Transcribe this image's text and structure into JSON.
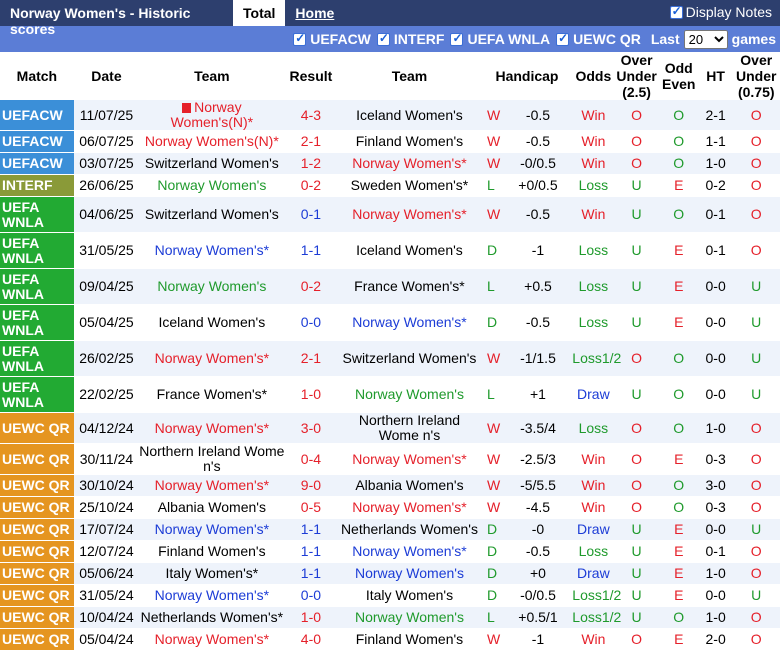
{
  "header": {
    "title": "Norway Women's - Historic scores",
    "tab_total": "Total",
    "tab_home": "Home",
    "display_notes": "Display Notes"
  },
  "filters": {
    "items": [
      "UEFACW",
      "INTERF",
      "UEFA WNLA",
      "UEWC QR"
    ],
    "last_label": "Last",
    "games_value": "20",
    "games_label": "games"
  },
  "columns": [
    "Match",
    "Date",
    "Team",
    "Result",
    "Team",
    "Handicap",
    "Odds",
    "Over Under (2.5)",
    "Odd Even",
    "HT",
    "Over Under (0.75)"
  ],
  "colors": {
    "win": "#e5202a",
    "draw": "#1c3cd6",
    "loss": "#1f9a2c",
    "uefacw": "#3b8fd8",
    "interf": "#8a9a38",
    "wnla": "#22aa33",
    "uewc": "#e59520"
  },
  "rows": [
    {
      "comp": "UEFACW",
      "ctype": "uefacw",
      "date": "11/07/25",
      "home": "Norway Women's(N)*",
      "hc": "red",
      "flag": true,
      "score": "4-3",
      "sc": "red",
      "away": "Iceland Women's",
      "ac": "black",
      "wl": "W",
      "wc": "red",
      "hcap": "-0.5",
      "odds": "Win",
      "oc": "red",
      "ou": "O",
      "ouc": "red",
      "oe": "O",
      "oec": "green",
      "ht": "2-1",
      "ou2": "O",
      "ou2c": "red",
      "tall": false
    },
    {
      "comp": "UEFACW",
      "ctype": "uefacw",
      "date": "06/07/25",
      "home": "Norway Women's(N)*",
      "hc": "red",
      "flag": false,
      "score": "2-1",
      "sc": "red",
      "away": "Finland Women's",
      "ac": "black",
      "wl": "W",
      "wc": "red",
      "hcap": "-0.5",
      "odds": "Win",
      "oc": "red",
      "ou": "O",
      "ouc": "red",
      "oe": "O",
      "oec": "green",
      "ht": "1-1",
      "ou2": "O",
      "ou2c": "red",
      "tall": false
    },
    {
      "comp": "UEFACW",
      "ctype": "uefacw",
      "date": "03/07/25",
      "home": "Switzerland Women's",
      "hc": "black",
      "flag": false,
      "score": "1-2",
      "sc": "red",
      "away": "Norway Women's*",
      "ac": "red",
      "wl": "W",
      "wc": "red",
      "hcap": "-0/0.5",
      "odds": "Win",
      "oc": "red",
      "ou": "O",
      "ouc": "red",
      "oe": "O",
      "oec": "green",
      "ht": "1-0",
      "ou2": "O",
      "ou2c": "red",
      "tall": false
    },
    {
      "comp": "INTERF",
      "ctype": "interf",
      "date": "26/06/25",
      "home": "Norway Women's",
      "hc": "green",
      "flag": false,
      "score": "0-2",
      "sc": "red",
      "away": "Sweden Women's*",
      "ac": "black",
      "wl": "L",
      "wc": "green",
      "hcap": "+0/0.5",
      "odds": "Loss",
      "oc": "green",
      "ou": "U",
      "ouc": "green",
      "oe": "E",
      "oec": "red",
      "ht": "0-2",
      "ou2": "O",
      "ou2c": "red",
      "tall": false
    },
    {
      "comp": "UEFA WNLA",
      "ctype": "wnla",
      "date": "04/06/25",
      "home": "Switzerland Women's",
      "hc": "black",
      "flag": false,
      "score": "0-1",
      "sc": "blue",
      "away": "Norway Women's*",
      "ac": "red",
      "wl": "W",
      "wc": "red",
      "hcap": "-0.5",
      "odds": "Win",
      "oc": "red",
      "ou": "U",
      "ouc": "green",
      "oe": "O",
      "oec": "green",
      "ht": "0-1",
      "ou2": "O",
      "ou2c": "red",
      "tall": true
    },
    {
      "comp": "UEFA WNLA",
      "ctype": "wnla",
      "date": "31/05/25",
      "home": "Norway Women's*",
      "hc": "blue",
      "flag": false,
      "score": "1-1",
      "sc": "blue",
      "away": "Iceland Women's",
      "ac": "black",
      "wl": "D",
      "wc": "green",
      "hcap": "-1",
      "odds": "Loss",
      "oc": "green",
      "ou": "U",
      "ouc": "green",
      "oe": "E",
      "oec": "red",
      "ht": "0-1",
      "ou2": "O",
      "ou2c": "red",
      "tall": true
    },
    {
      "comp": "UEFA WNLA",
      "ctype": "wnla",
      "date": "09/04/25",
      "home": "Norway Women's",
      "hc": "green",
      "flag": false,
      "score": "0-2",
      "sc": "red",
      "away": "France Women's*",
      "ac": "black",
      "wl": "L",
      "wc": "green",
      "hcap": "+0.5",
      "odds": "Loss",
      "oc": "green",
      "ou": "U",
      "ouc": "green",
      "oe": "E",
      "oec": "red",
      "ht": "0-0",
      "ou2": "U",
      "ou2c": "green",
      "tall": true
    },
    {
      "comp": "UEFA WNLA",
      "ctype": "wnla",
      "date": "05/04/25",
      "home": "Iceland Women's",
      "hc": "black",
      "flag": false,
      "score": "0-0",
      "sc": "blue",
      "away": "Norway Women's*",
      "ac": "blue",
      "wl": "D",
      "wc": "green",
      "hcap": "-0.5",
      "odds": "Loss",
      "oc": "green",
      "ou": "U",
      "ouc": "green",
      "oe": "E",
      "oec": "red",
      "ht": "0-0",
      "ou2": "U",
      "ou2c": "green",
      "tall": true
    },
    {
      "comp": "UEFA WNLA",
      "ctype": "wnla",
      "date": "26/02/25",
      "home": "Norway Women's*",
      "hc": "red",
      "flag": false,
      "score": "2-1",
      "sc": "red",
      "away": "Switzerland Women's",
      "ac": "black",
      "wl": "W",
      "wc": "red",
      "hcap": "-1/1.5",
      "odds": "Loss1/2",
      "oc": "green",
      "ou": "O",
      "ouc": "red",
      "oe": "O",
      "oec": "green",
      "ht": "0-0",
      "ou2": "U",
      "ou2c": "green",
      "tall": true
    },
    {
      "comp": "UEFA WNLA",
      "ctype": "wnla",
      "date": "22/02/25",
      "home": "France Women's*",
      "hc": "black",
      "flag": false,
      "score": "1-0",
      "sc": "red",
      "away": "Norway Women's",
      "ac": "green",
      "wl": "L",
      "wc": "green",
      "hcap": "+1",
      "odds": "Draw",
      "oc": "blue",
      "ou": "U",
      "ouc": "green",
      "oe": "O",
      "oec": "green",
      "ht": "0-0",
      "ou2": "U",
      "ou2c": "green",
      "tall": true
    },
    {
      "comp": "UEWC QR",
      "ctype": "uewc",
      "date": "04/12/24",
      "home": "Norway Women's*",
      "hc": "red",
      "flag": false,
      "score": "3-0",
      "sc": "red",
      "away": "Northern Ireland Wome n's",
      "ac": "black",
      "wl": "W",
      "wc": "red",
      "hcap": "-3.5/4",
      "odds": "Loss",
      "oc": "green",
      "ou": "O",
      "ouc": "red",
      "oe": "O",
      "oec": "green",
      "ht": "1-0",
      "ou2": "O",
      "ou2c": "red",
      "tall": false
    },
    {
      "comp": "UEWC QR",
      "ctype": "uewc",
      "date": "30/11/24",
      "home": "Northern Ireland Wome n's",
      "hc": "black",
      "flag": false,
      "score": "0-4",
      "sc": "red",
      "away": "Norway Women's*",
      "ac": "red",
      "wl": "W",
      "wc": "red",
      "hcap": "-2.5/3",
      "odds": "Win",
      "oc": "red",
      "ou": "O",
      "ouc": "red",
      "oe": "E",
      "oec": "red",
      "ht": "0-3",
      "ou2": "O",
      "ou2c": "red",
      "tall": false
    },
    {
      "comp": "UEWC QR",
      "ctype": "uewc",
      "date": "30/10/24",
      "home": "Norway Women's*",
      "hc": "red",
      "flag": false,
      "score": "9-0",
      "sc": "red",
      "away": "Albania Women's",
      "ac": "black",
      "wl": "W",
      "wc": "red",
      "hcap": "-5/5.5",
      "odds": "Win",
      "oc": "red",
      "ou": "O",
      "ouc": "red",
      "oe": "O",
      "oec": "green",
      "ht": "3-0",
      "ou2": "O",
      "ou2c": "red",
      "tall": false
    },
    {
      "comp": "UEWC QR",
      "ctype": "uewc",
      "date": "25/10/24",
      "home": "Albania Women's",
      "hc": "black",
      "flag": false,
      "score": "0-5",
      "sc": "red",
      "away": "Norway Women's*",
      "ac": "red",
      "wl": "W",
      "wc": "red",
      "hcap": "-4.5",
      "odds": "Win",
      "oc": "red",
      "ou": "O",
      "ouc": "red",
      "oe": "O",
      "oec": "green",
      "ht": "0-3",
      "ou2": "O",
      "ou2c": "red",
      "tall": false
    },
    {
      "comp": "UEWC QR",
      "ctype": "uewc",
      "date": "17/07/24",
      "home": "Norway Women's*",
      "hc": "blue",
      "flag": false,
      "score": "1-1",
      "sc": "blue",
      "away": "Netherlands Women's",
      "ac": "black",
      "wl": "D",
      "wc": "green",
      "hcap": "-0",
      "odds": "Draw",
      "oc": "blue",
      "ou": "U",
      "ouc": "green",
      "oe": "E",
      "oec": "red",
      "ht": "0-0",
      "ou2": "U",
      "ou2c": "green",
      "tall": false
    },
    {
      "comp": "UEWC QR",
      "ctype": "uewc",
      "date": "12/07/24",
      "home": "Finland Women's",
      "hc": "black",
      "flag": false,
      "score": "1-1",
      "sc": "blue",
      "away": "Norway Women's*",
      "ac": "blue",
      "wl": "D",
      "wc": "green",
      "hcap": "-0.5",
      "odds": "Loss",
      "oc": "green",
      "ou": "U",
      "ouc": "green",
      "oe": "E",
      "oec": "red",
      "ht": "0-1",
      "ou2": "O",
      "ou2c": "red",
      "tall": false
    },
    {
      "comp": "UEWC QR",
      "ctype": "uewc",
      "date": "05/06/24",
      "home": "Italy Women's*",
      "hc": "black",
      "flag": false,
      "score": "1-1",
      "sc": "blue",
      "away": "Norway Women's",
      "ac": "blue",
      "wl": "D",
      "wc": "green",
      "hcap": "+0",
      "odds": "Draw",
      "oc": "blue",
      "ou": "U",
      "ouc": "green",
      "oe": "E",
      "oec": "red",
      "ht": "1-0",
      "ou2": "O",
      "ou2c": "red",
      "tall": false
    },
    {
      "comp": "UEWC QR",
      "ctype": "uewc",
      "date": "31/05/24",
      "home": "Norway Women's*",
      "hc": "blue",
      "flag": false,
      "score": "0-0",
      "sc": "blue",
      "away": "Italy Women's",
      "ac": "black",
      "wl": "D",
      "wc": "green",
      "hcap": "-0/0.5",
      "odds": "Loss1/2",
      "oc": "green",
      "ou": "U",
      "ouc": "green",
      "oe": "E",
      "oec": "red",
      "ht": "0-0",
      "ou2": "U",
      "ou2c": "green",
      "tall": false
    },
    {
      "comp": "UEWC QR",
      "ctype": "uewc",
      "date": "10/04/24",
      "home": "Netherlands Women's*",
      "hc": "black",
      "flag": false,
      "score": "1-0",
      "sc": "red",
      "away": "Norway Women's",
      "ac": "green",
      "wl": "L",
      "wc": "green",
      "hcap": "+0.5/1",
      "odds": "Loss1/2",
      "oc": "green",
      "ou": "U",
      "ouc": "green",
      "oe": "O",
      "oec": "green",
      "ht": "1-0",
      "ou2": "O",
      "ou2c": "red",
      "tall": false
    },
    {
      "comp": "UEWC QR",
      "ctype": "uewc",
      "date": "05/04/24",
      "home": "Norway Women's*",
      "hc": "red",
      "flag": false,
      "score": "4-0",
      "sc": "red",
      "away": "Finland Women's",
      "ac": "black",
      "wl": "W",
      "wc": "red",
      "hcap": "-1",
      "odds": "Win",
      "oc": "red",
      "ou": "O",
      "ouc": "red",
      "oe": "E",
      "oec": "red",
      "ht": "2-0",
      "ou2": "O",
      "ou2c": "red",
      "tall": false
    }
  ]
}
